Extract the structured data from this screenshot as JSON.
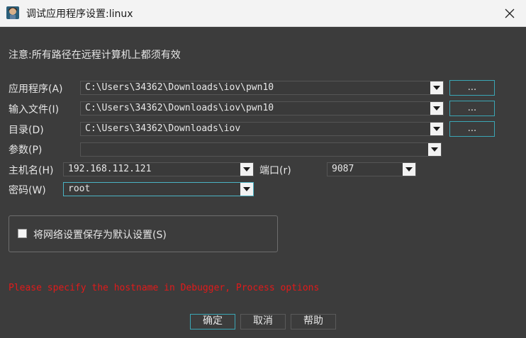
{
  "window": {
    "title": "调试应用程序设置:linux"
  },
  "note": "注意:所有路径在远程计算机上都须有效",
  "fields": {
    "application": {
      "label": "应用程序(A)",
      "value": "C:\\Users\\34362\\Downloads\\iov\\pwn10",
      "browse_label": "..."
    },
    "input_file": {
      "label": "输入文件(I)",
      "value": "C:\\Users\\34362\\Downloads\\iov\\pwn10",
      "browse_label": "..."
    },
    "directory": {
      "label": "目录(D)",
      "value": "C:\\Users\\34362\\Downloads\\iov",
      "browse_label": "..."
    },
    "parameters": {
      "label": "参数(P)",
      "value": ""
    },
    "hostname": {
      "label": "主机名(H)",
      "value": "192.168.112.121"
    },
    "port": {
      "label": "端口(r)",
      "value": "9087"
    },
    "password": {
      "label": "密码(W)",
      "value": "root"
    }
  },
  "save_default": {
    "label": "将网络设置保存为默认设置(S)",
    "checked": false
  },
  "error_message": "Please specify the hostname in Debugger, Process options",
  "buttons": {
    "ok": "确定",
    "cancel": "取消",
    "help": "帮助"
  },
  "colors": {
    "accent": "#3ba6b5",
    "error": "#e21a1a",
    "background": "#3c3c3c"
  }
}
